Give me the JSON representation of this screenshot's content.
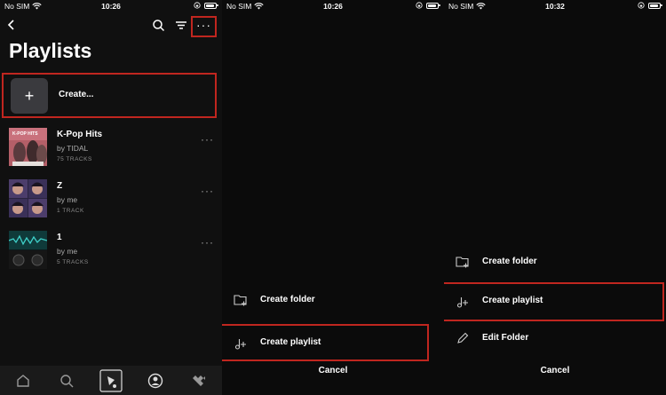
{
  "status_bars": [
    {
      "carrier": "No SIM",
      "time": "10:26"
    },
    {
      "carrier": "No SIM",
      "time": "10:26"
    },
    {
      "carrier": "No SIM",
      "time": "10:32"
    }
  ],
  "playlists_screen": {
    "title": "Playlists",
    "create_label": "Create...",
    "create_symbol": "+",
    "more_symbol": "···",
    "playlists": [
      {
        "title": "K-Pop Hits",
        "owner": "by TIDAL",
        "tracks": "75 TRACKS",
        "cover_text": "K-POP HITS"
      },
      {
        "title": "Z",
        "owner": "by me",
        "tracks": "1 TRACK"
      },
      {
        "title": "1",
        "owner": "by me",
        "tracks": "5 TRACKS"
      }
    ],
    "row_more_symbol": "···"
  },
  "sheet_one": {
    "items": [
      {
        "label": "Create folder",
        "icon": "folder-plus-icon"
      },
      {
        "label": "Create playlist",
        "icon": "music-plus-icon"
      }
    ],
    "cancel": "Cancel"
  },
  "sheet_two": {
    "items": [
      {
        "label": "Create folder",
        "icon": "folder-plus-icon"
      },
      {
        "label": "Create playlist",
        "icon": "music-plus-icon"
      },
      {
        "label": "Edit Folder",
        "icon": "pencil-icon"
      }
    ],
    "cancel": "Cancel"
  },
  "colors": {
    "highlight": "#c0261f",
    "background": "#101010",
    "tile": "#3a3a3e"
  }
}
